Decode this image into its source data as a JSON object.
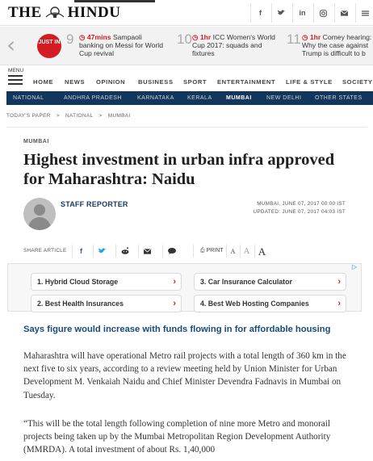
{
  "header": {
    "logo_left": "THE",
    "logo_right": "HINDU",
    "social": [
      "f",
      "t",
      "in",
      "ig",
      "mail",
      "more"
    ]
  },
  "ticker": {
    "badge": "JUST IN",
    "items": [
      {
        "num": "9",
        "time": "47mins",
        "text": "Sampaoli banking on Messi for World Cup revival"
      },
      {
        "num": "10",
        "time": "1hr",
        "text": "ICC Women's World Cup 2017: squads and fixtures"
      },
      {
        "num": "11",
        "time": "1hr",
        "text": "Comey hearing: Why the case against Trump is difficult to b"
      }
    ]
  },
  "nav": {
    "menu_label": "MENU",
    "items": [
      "HOME",
      "NEWS",
      "OPINION",
      "BUSINESS",
      "SPORT",
      "ENTERTAINMENT",
      "LIFE & STYLE",
      "SOCIETY"
    ]
  },
  "subnav": {
    "items": [
      "NATIONAL",
      "ANDHRA PRADESH",
      "KARNATAKA",
      "KERALA",
      "MUMBAI",
      "NEW DELHI",
      "OTHER STATES"
    ],
    "active": "MUMBAI"
  },
  "breadcrumb": [
    "TODAY'S PAPER",
    ">",
    "NATIONAL",
    ">",
    "MUMBAI"
  ],
  "article": {
    "section": "MUMBAI",
    "headline": "Highest investment in urban infra approved for Maharashtra: Naidu",
    "author": "STAFF REPORTER",
    "published": "MUMBAI, JUNE 07, 2017 00:00 IST",
    "updated": "UPDATED: JUNE 07, 2017 04:03 IST",
    "share_label": "SHARE ARTICLE",
    "print_label": "PRINT",
    "font_sizes": [
      "A",
      "A",
      "A"
    ],
    "standfirst": "Says figure would increase with funds flowing in for affordable housing",
    "paragraphs": [
      "Maharashtra will have operational Metro rail projects with a total length of 360 km in the next five to six years, according to a review meeting held by Union Minister for Urban Development M. Venkaiah Naidu and Chief Minister Devendra Fadnavis in Mumbai on Tuesday.",
      "“This will be the total length following completion of nine more Metro and monorail projects being taken up by the Mumbai Metropolitan Region Development Authority (MMRDA). A total investment of about Rs. 1,40,000"
    ]
  },
  "ads": {
    "links": [
      "1.  Hybrid Cloud Storage",
      "3.  Car Insurance Calculator",
      "2.  Best Health Insurances",
      "4.  Best Web Hosting Companies"
    ],
    "chevron": "›",
    "choice": "▷"
  },
  "colors": {
    "accent_red": "#d41b22",
    "subnav_bg": "#13375c",
    "standfirst_blue": "#174a7c"
  }
}
